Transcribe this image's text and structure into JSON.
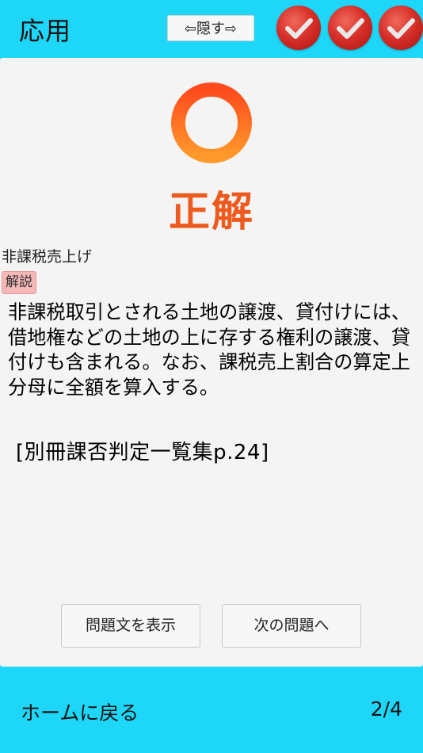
{
  "header": {
    "title": "応用",
    "hide_button_label": "⇦隠す⇨",
    "checkmarks": [
      {
        "icon": "check-icon",
        "state": "correct",
        "color": "#d8302a"
      },
      {
        "icon": "check-icon",
        "state": "correct",
        "color": "#d8302a"
      },
      {
        "icon": "check-icon",
        "state": "correct",
        "color": "#d8302a"
      }
    ]
  },
  "result": {
    "icon": "circle-correct-icon",
    "label": "正解",
    "color": "#ee5a1e"
  },
  "question": {
    "topic": "非課税売上げ",
    "explanation_badge": "解説",
    "explanation": "非課税取引とされる土地の譲渡、貸付けには、借地権などの土地の上に存する権利の譲渡、貸付けも含まれる。なお、課税売上割合の算定上分母に全額を算入する。",
    "reference": "[別冊課否判定一覧集p.24]"
  },
  "actions": {
    "show_question_label": "問題文を表示",
    "next_question_label": "次の問題へ"
  },
  "footer": {
    "home_label": "ホームに戻る",
    "progress": "2/4"
  },
  "colors": {
    "background": "#1ed6f7",
    "card": "#f4f4f4",
    "badge": "#f6b7b7"
  }
}
